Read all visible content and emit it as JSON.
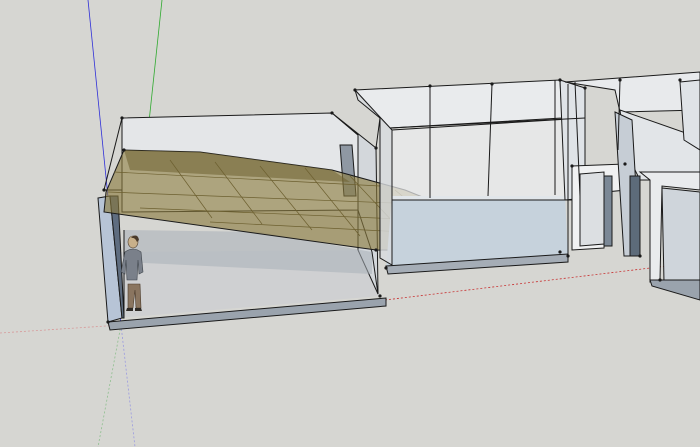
{
  "viewport": {
    "background": "#d6d6d2",
    "colors": {
      "edge": "#1a1a1a",
      "glass": "#e4e8ec",
      "floor_light": "#cfd0d2",
      "floor_blue": "#c6d2dc",
      "wall_face": "#e9ebed",
      "wall_shadow": "#9aa3ad",
      "roof_fill": "#8a7a3e",
      "roof_edge": "#6d6030",
      "axis_red": "#c83232",
      "axis_green": "#2faa2f",
      "axis_blue": "#2f2fd8"
    }
  },
  "model": {
    "scale_figure": "person-figure",
    "objects": [
      "left-pavilion",
      "inclined-roof-panel",
      "rear-pavilion",
      "side-wing"
    ]
  }
}
